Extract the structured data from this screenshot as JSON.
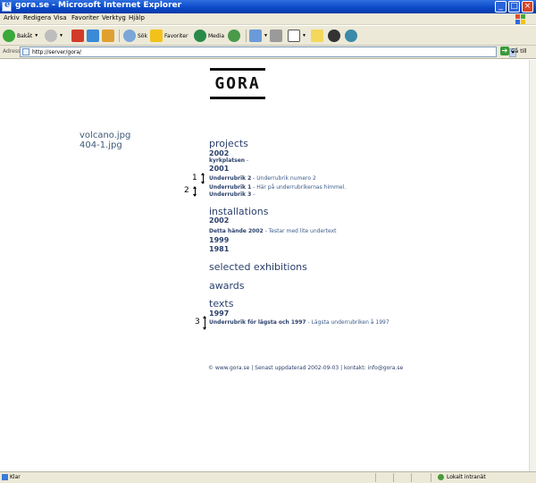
{
  "window": {
    "title": "gora.se - Microsoft Internet Explorer"
  },
  "menubar": [
    "Arkiv",
    "Redigera",
    "Visa",
    "Favoriter",
    "Verktyg",
    "Hjälp"
  ],
  "toolbar": {
    "back": "Bakåt",
    "search": "Sök",
    "favorites": "Favoriter",
    "media": "Media"
  },
  "address": {
    "label": "Adress",
    "url": "http://server/gora/",
    "go": "Gå till"
  },
  "logo": {
    "text": "GORA"
  },
  "files": [
    "volcano.jpg",
    "404-1.jpg"
  ],
  "nav": {
    "projects": {
      "title": "projects",
      "year_2002": "2002",
      "kyrkplatsen": "kyrkplatsen",
      "kyrkplatsen_dash": " -",
      "year_2001": "2001",
      "sub1_bold": "Underrubrik 2",
      "sub1_desc": " - Underrubrik numero 2",
      "sub2_bold": "Underrubrik 1",
      "sub2_desc": " - Här på underrubrikernas himmel.",
      "sub3_bold": "Underrubrik 3",
      "sub3_desc": " -"
    },
    "installations": {
      "title": "installations",
      "year_2002": "2002",
      "sub_bold": "Detta hände 2002",
      "sub_desc": " - Testar med lite undertext",
      "year_1999": "1999",
      "year_1981": "1981"
    },
    "selected_exhibitions": "selected exhibitions",
    "awards": "awards",
    "texts": {
      "title": "texts",
      "year_1997": "1997",
      "sub_bold": "Underrubrik för lägsta och 1997",
      "sub_desc": " - Lägsta underrubriken å 1997"
    }
  },
  "markers": [
    "1",
    "2",
    "3"
  ],
  "footer": "© www.gora.se | Senast uppdaterad 2002-09-03 | kontakt: info@gora.se",
  "status": {
    "left": "Klar",
    "right": "Lokalt intranät"
  }
}
